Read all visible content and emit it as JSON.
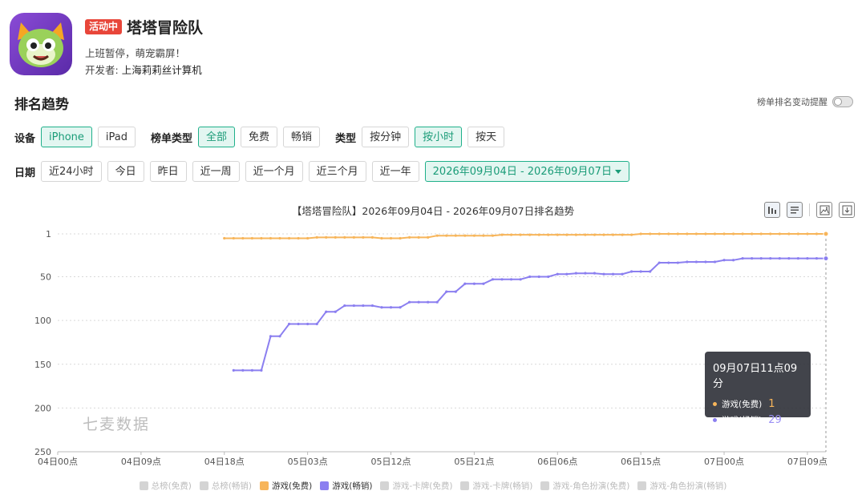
{
  "app": {
    "badge": "活动中",
    "name": "塔塔冒险队",
    "slogan": "上班暂停，萌宠霸屏！",
    "developer_label": "开发者: ",
    "developer": "上海莉莉丝计算机"
  },
  "section_title": "排名趋势",
  "alert_label": "榜单排名变动提醒",
  "filters": {
    "device_label": "设备",
    "devices": [
      "iPhone",
      "iPad"
    ],
    "chart_type_label": "榜单类型",
    "chart_types": [
      "全部",
      "免费",
      "畅销"
    ],
    "type_label": "类型",
    "types": [
      "按分钟",
      "按小时",
      "按天"
    ],
    "date_label": "日期",
    "dates": [
      "近24小时",
      "今日",
      "昨日",
      "近一周",
      "近一个月",
      "近三个月",
      "近一年"
    ],
    "date_range": "2026年09月04日 - 2026年09月07日"
  },
  "chart_title": "【塔塔冒险队】2026年09月04日 - 2026年09月07日排名趋势",
  "watermark": "七麦数据",
  "tooltip": {
    "time": "09月07日11点09分",
    "rows": [
      {
        "name": "游戏(免费)",
        "value": "1"
      },
      {
        "name": "游戏(畅销)",
        "value": "29"
      }
    ]
  },
  "legend": [
    {
      "name": "总榜(免费)",
      "active": false,
      "color": "#d4d4d4"
    },
    {
      "name": "总榜(畅销)",
      "active": false,
      "color": "#d4d4d4"
    },
    {
      "name": "游戏(免费)",
      "active": true,
      "color": "#f7b55a"
    },
    {
      "name": "游戏(畅销)",
      "active": true,
      "color": "#8b7ff0"
    },
    {
      "name": "游戏-卡牌(免费)",
      "active": false,
      "color": "#d4d4d4"
    },
    {
      "name": "游戏-卡牌(畅销)",
      "active": false,
      "color": "#d4d4d4"
    },
    {
      "name": "游戏-角色扮演(免费)",
      "active": false,
      "color": "#d4d4d4"
    },
    {
      "name": "游戏-角色扮演(畅销)",
      "active": false,
      "color": "#d4d4d4"
    }
  ],
  "chart_data": {
    "type": "line",
    "x_unit": "hours since 09月04日00点",
    "xlim": [
      0,
      83
    ],
    "x_ticks": [
      0,
      9,
      18,
      27,
      36,
      45,
      54,
      63,
      72,
      81
    ],
    "x_tick_labels": [
      "04日00点",
      "04日09点",
      "04日18点",
      "05日03点",
      "05日12点",
      "05日21点",
      "06日06点",
      "06日15点",
      "07日00点",
      "07日09点"
    ],
    "y_ticks": [
      1,
      50,
      100,
      150,
      200,
      250
    ],
    "ylim": [
      250,
      1
    ],
    "y_reversed": true,
    "grid": true,
    "series": [
      {
        "name": "游戏(免费)",
        "color": "#f7b55a",
        "points": [
          [
            18,
            6
          ],
          [
            19,
            6
          ],
          [
            20,
            6
          ],
          [
            21,
            6
          ],
          [
            22,
            6
          ],
          [
            23,
            6
          ],
          [
            24,
            6
          ],
          [
            25,
            6
          ],
          [
            26,
            6
          ],
          [
            27,
            6
          ],
          [
            28,
            5
          ],
          [
            29,
            5
          ],
          [
            30,
            5
          ],
          [
            31,
            5
          ],
          [
            32,
            5
          ],
          [
            33,
            5
          ],
          [
            34,
            5
          ],
          [
            35,
            6
          ],
          [
            36,
            6
          ],
          [
            37,
            6
          ],
          [
            38,
            5
          ],
          [
            39,
            5
          ],
          [
            40,
            5
          ],
          [
            41,
            3
          ],
          [
            42,
            3
          ],
          [
            43,
            3
          ],
          [
            44,
            3
          ],
          [
            45,
            3
          ],
          [
            46,
            3
          ],
          [
            47,
            3
          ],
          [
            48,
            2
          ],
          [
            49,
            2
          ],
          [
            50,
            2
          ],
          [
            51,
            2
          ],
          [
            52,
            2
          ],
          [
            53,
            2
          ],
          [
            54,
            2
          ],
          [
            55,
            2
          ],
          [
            56,
            2
          ],
          [
            57,
            2
          ],
          [
            58,
            2
          ],
          [
            59,
            2
          ],
          [
            60,
            2
          ],
          [
            61,
            2
          ],
          [
            62,
            2
          ],
          [
            63,
            1
          ],
          [
            64,
            1
          ],
          [
            65,
            1
          ],
          [
            66,
            1
          ],
          [
            67,
            1
          ],
          [
            68,
            1
          ],
          [
            69,
            1
          ],
          [
            70,
            1
          ],
          [
            71,
            1
          ],
          [
            72,
            1
          ],
          [
            73,
            1
          ],
          [
            74,
            1
          ],
          [
            75,
            1
          ],
          [
            76,
            1
          ],
          [
            77,
            1
          ],
          [
            78,
            1
          ],
          [
            79,
            1
          ],
          [
            80,
            1
          ],
          [
            81,
            1
          ],
          [
            82,
            1
          ],
          [
            83,
            1
          ]
        ]
      },
      {
        "name": "游戏(畅销)",
        "color": "#8b7ff0",
        "points": [
          [
            19,
            157
          ],
          [
            20,
            157
          ],
          [
            21,
            157
          ],
          [
            22,
            157
          ],
          [
            23,
            118
          ],
          [
            24,
            118
          ],
          [
            25,
            104
          ],
          [
            26,
            104
          ],
          [
            27,
            104
          ],
          [
            28,
            104
          ],
          [
            29,
            90
          ],
          [
            30,
            90
          ],
          [
            31,
            83
          ],
          [
            32,
            83
          ],
          [
            33,
            83
          ],
          [
            34,
            83
          ],
          [
            35,
            85
          ],
          [
            36,
            85
          ],
          [
            37,
            85
          ],
          [
            38,
            79
          ],
          [
            39,
            79
          ],
          [
            40,
            79
          ],
          [
            41,
            79
          ],
          [
            42,
            67
          ],
          [
            43,
            67
          ],
          [
            44,
            58
          ],
          [
            45,
            58
          ],
          [
            46,
            58
          ],
          [
            47,
            53
          ],
          [
            48,
            53
          ],
          [
            49,
            53
          ],
          [
            50,
            53
          ],
          [
            51,
            50
          ],
          [
            52,
            50
          ],
          [
            53,
            50
          ],
          [
            54,
            47
          ],
          [
            55,
            47
          ],
          [
            56,
            46
          ],
          [
            57,
            46
          ],
          [
            58,
            46
          ],
          [
            59,
            47
          ],
          [
            60,
            47
          ],
          [
            61,
            47
          ],
          [
            62,
            44
          ],
          [
            63,
            44
          ],
          [
            64,
            44
          ],
          [
            65,
            34
          ],
          [
            66,
            34
          ],
          [
            67,
            34
          ],
          [
            68,
            33
          ],
          [
            69,
            33
          ],
          [
            70,
            33
          ],
          [
            71,
            33
          ],
          [
            72,
            31
          ],
          [
            73,
            31
          ],
          [
            74,
            29
          ],
          [
            75,
            29
          ],
          [
            76,
            29
          ],
          [
            77,
            29
          ],
          [
            78,
            29
          ],
          [
            79,
            29
          ],
          [
            80,
            29
          ],
          [
            81,
            29
          ],
          [
            82,
            29
          ],
          [
            83,
            29
          ]
        ]
      }
    ],
    "cursor_x": 83
  }
}
